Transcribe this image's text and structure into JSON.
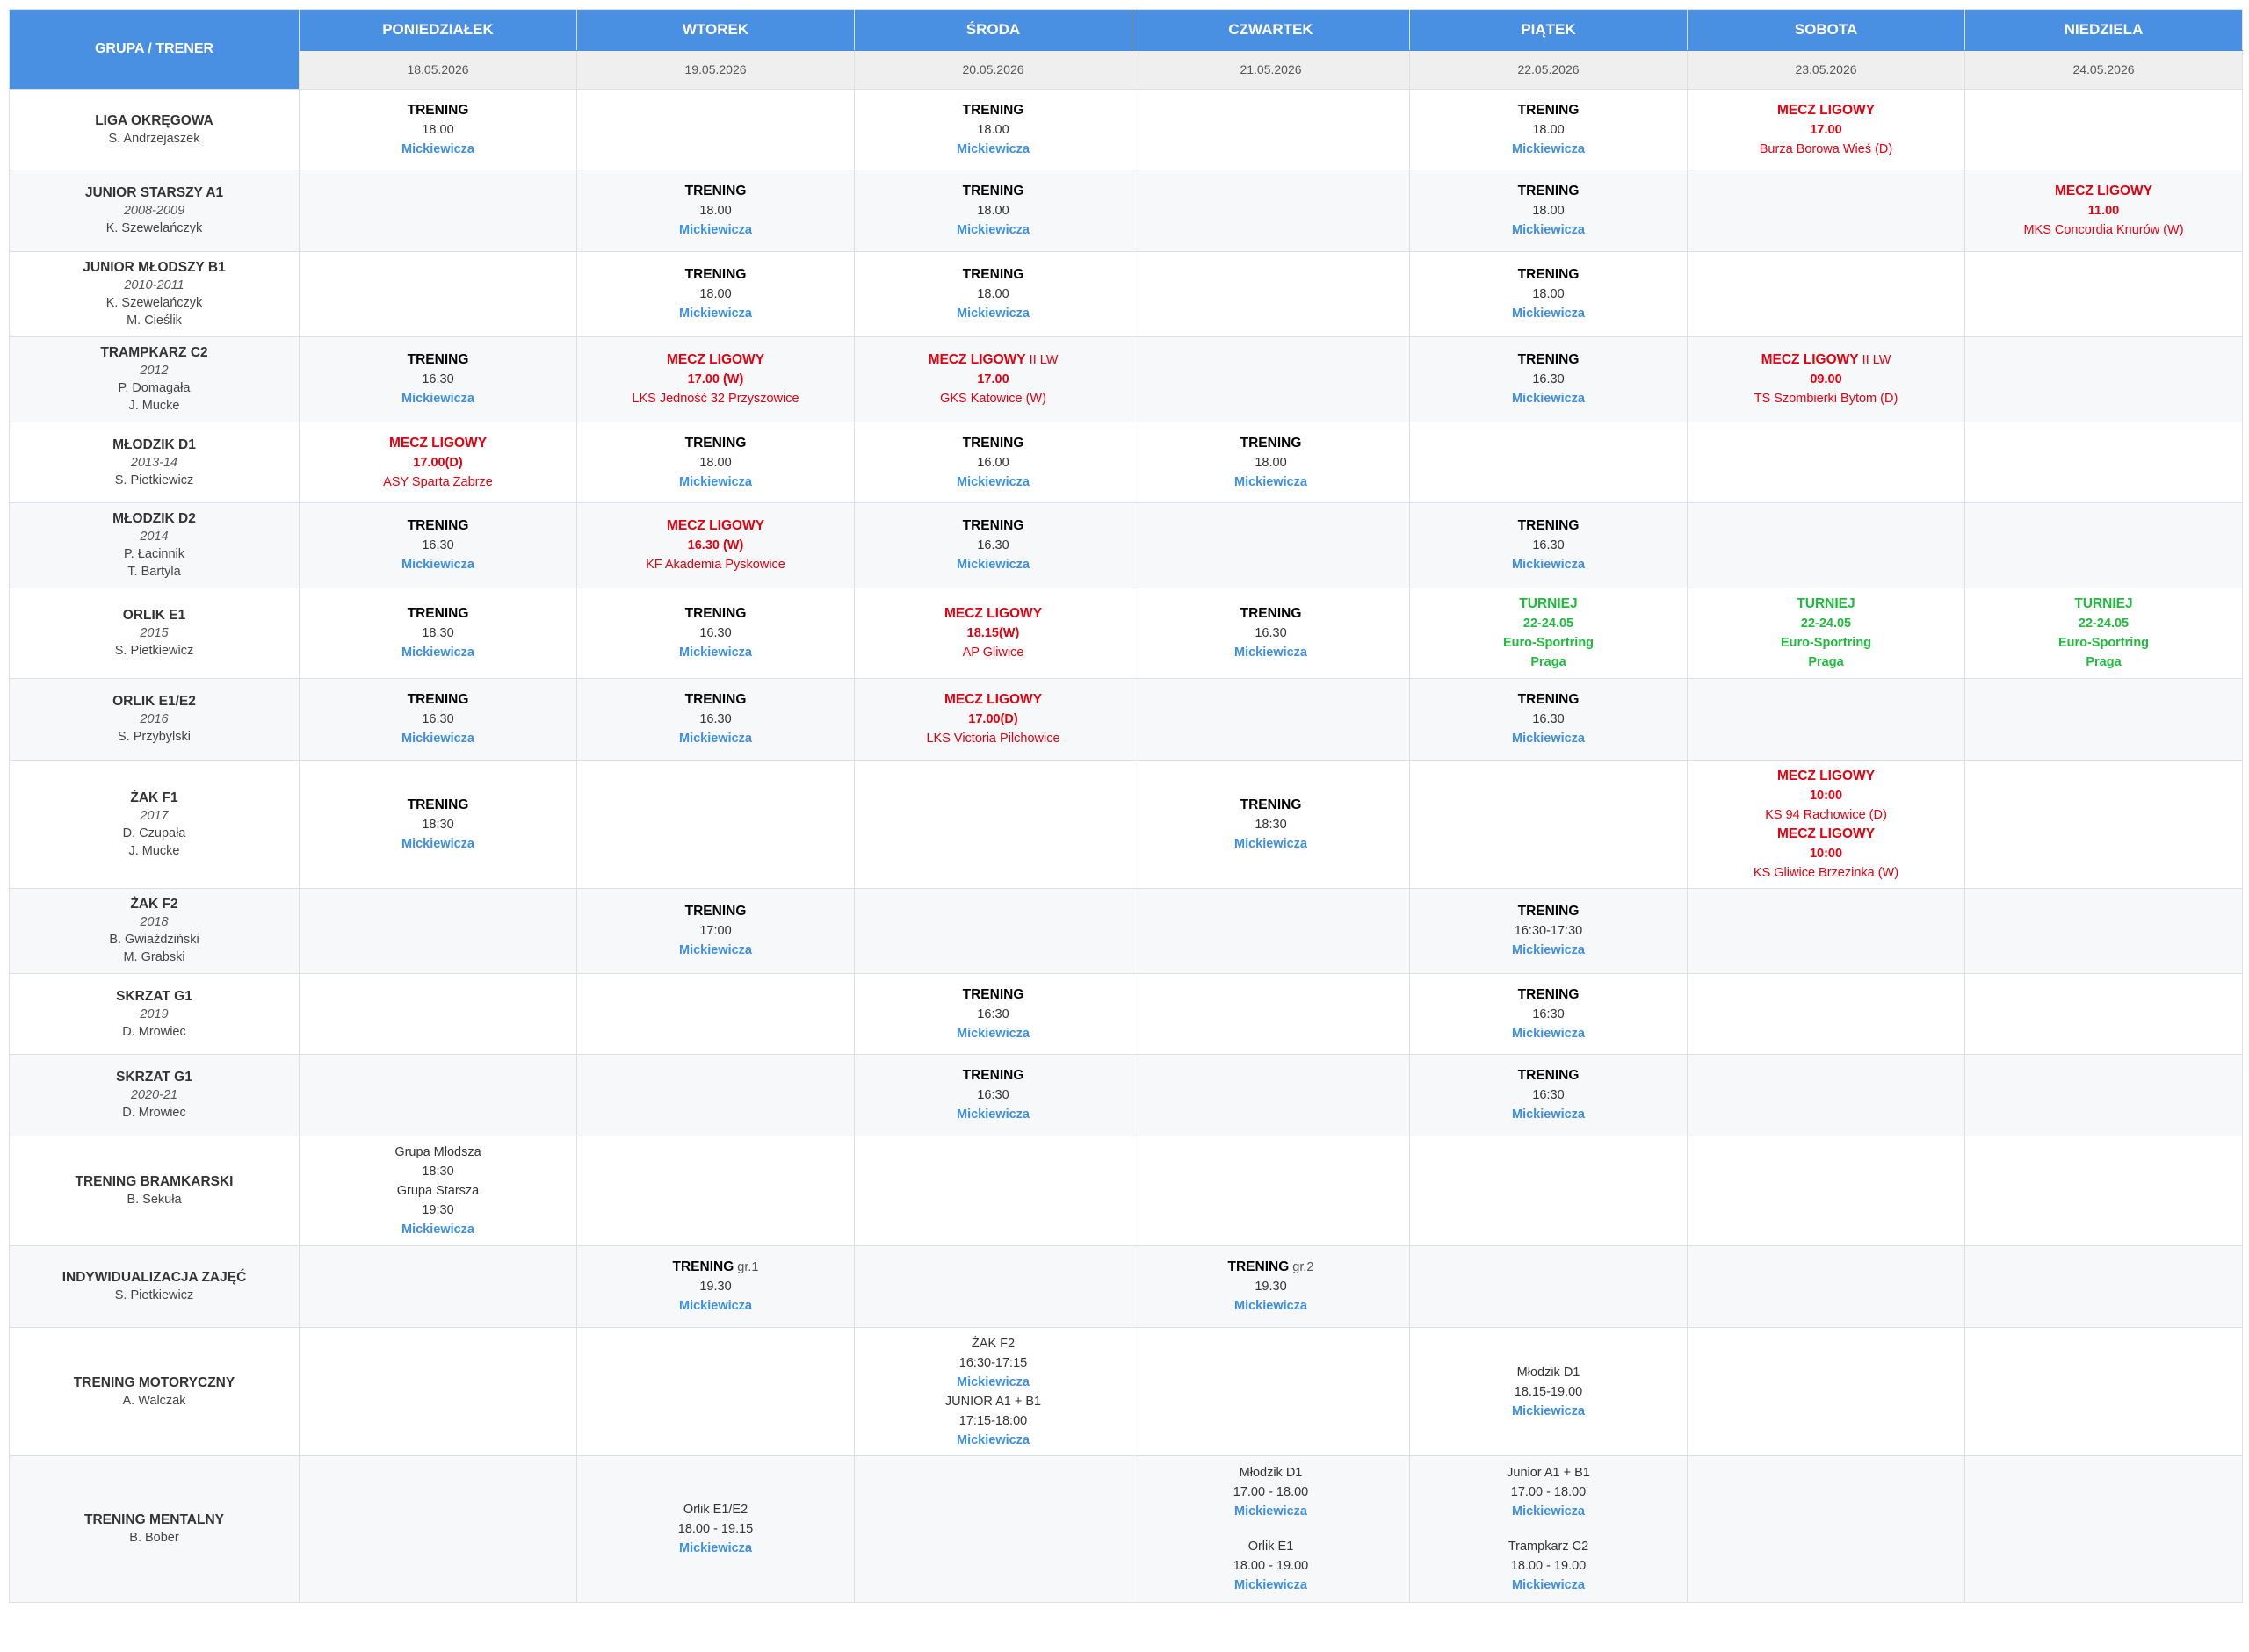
{
  "header": {
    "group_label": "GRUPA / TRENER",
    "days": [
      {
        "name": "PONIEDZIAŁEK",
        "date": "18.05.2026"
      },
      {
        "name": "WTOREK",
        "date": "19.05.2026"
      },
      {
        "name": "ŚRODA",
        "date": "20.05.2026"
      },
      {
        "name": "CZWARTEK",
        "date": "21.05.2026"
      },
      {
        "name": "PIĄTEK",
        "date": "22.05.2026"
      },
      {
        "name": "SOBOTA",
        "date": "23.05.2026"
      },
      {
        "name": "NIEDZIELA",
        "date": "24.05.2026"
      }
    ]
  },
  "colors": {
    "header_blue": "#4a90e2",
    "location_blue": "#3d8fe2",
    "match_red": "#e3000f",
    "tournament_green": "#1fbb3c",
    "alt_row": "#f7f8fa"
  },
  "rows": [
    {
      "group": {
        "name": "LIGA OKRĘGOWA",
        "year": "",
        "coaches": [
          "S. Andrzejaszek"
        ]
      },
      "height": 92,
      "cells": [
        [
          {
            "t": "type",
            "v": "TRENING"
          },
          {
            "t": "text",
            "v": "18.00"
          },
          {
            "t": "loc",
            "v": "Mickiewicza"
          }
        ],
        [],
        [
          {
            "t": "type",
            "v": "TRENING"
          },
          {
            "t": "text",
            "v": "18.00"
          },
          {
            "t": "loc",
            "v": "Mickiewicza"
          }
        ],
        [],
        [
          {
            "t": "type",
            "v": "TRENING"
          },
          {
            "t": "text",
            "v": "18.00"
          },
          {
            "t": "loc",
            "v": "Mickiewicza"
          }
        ],
        [
          {
            "t": "match",
            "v": "MECZ LIGOWY"
          },
          {
            "t": "red_bold",
            "v": "17.00"
          },
          {
            "t": "red",
            "v": "Burza Borowa Wieś (D)"
          }
        ],
        []
      ]
    },
    {
      "group": {
        "name": "JUNIOR STARSZY A1",
        "year": "2008-2009",
        "coaches": [
          "K. Szewelańczyk"
        ]
      },
      "height": 93,
      "cells": [
        [],
        [
          {
            "t": "type",
            "v": "TRENING"
          },
          {
            "t": "text",
            "v": "18.00"
          },
          {
            "t": "loc",
            "v": "Mickiewicza"
          }
        ],
        [
          {
            "t": "type",
            "v": "TRENING"
          },
          {
            "t": "text",
            "v": "18.00"
          },
          {
            "t": "loc",
            "v": "Mickiewicza"
          }
        ],
        [],
        [
          {
            "t": "type",
            "v": "TRENING"
          },
          {
            "t": "text",
            "v": "18.00"
          },
          {
            "t": "loc",
            "v": "Mickiewicza"
          }
        ],
        [],
        [
          {
            "t": "match",
            "v": "MECZ LIGOWY"
          },
          {
            "t": "red_bold",
            "v": "11.00"
          },
          {
            "t": "red",
            "v": "MKS Concordia Knurów (W)"
          }
        ]
      ]
    },
    {
      "group": {
        "name": "JUNIOR MŁODSZY B1",
        "year": "2010-2011",
        "coaches": [
          "K. Szewelańczyk",
          "M. Cieślik"
        ]
      },
      "height": 97,
      "cells": [
        [],
        [
          {
            "t": "type",
            "v": "TRENING"
          },
          {
            "t": "text",
            "v": "18.00"
          },
          {
            "t": "loc",
            "v": "Mickiewicza"
          }
        ],
        [
          {
            "t": "type",
            "v": "TRENING"
          },
          {
            "t": "text",
            "v": "18.00"
          },
          {
            "t": "loc",
            "v": "Mickiewicza"
          }
        ],
        [],
        [
          {
            "t": "type",
            "v": "TRENING"
          },
          {
            "t": "text",
            "v": "18.00"
          },
          {
            "t": "loc",
            "v": "Mickiewicza"
          }
        ],
        [],
        []
      ]
    },
    {
      "group": {
        "name": "TRAMPKARZ C2",
        "year": "2012",
        "coaches": [
          "P. Domagała",
          "J. Mucke"
        ]
      },
      "height": 97,
      "cells": [
        [
          {
            "t": "type",
            "v": "TRENING"
          },
          {
            "t": "text",
            "v": "16.30"
          },
          {
            "t": "loc",
            "v": "Mickiewicza"
          }
        ],
        [
          {
            "t": "match",
            "v": "MECZ LIGOWY"
          },
          {
            "t": "red_bold",
            "v": "17.00 (W)"
          },
          {
            "t": "red",
            "v": "LKS Jedność 32 Przyszowice"
          }
        ],
        [
          {
            "t": "match",
            "v": "MECZ LIGOWY",
            "s": "II LW"
          },
          {
            "t": "red_bold",
            "v": "17.00"
          },
          {
            "t": "red",
            "v": "GKS Katowice (W)"
          }
        ],
        [],
        [
          {
            "t": "type",
            "v": "TRENING"
          },
          {
            "t": "text",
            "v": "16.30"
          },
          {
            "t": "loc",
            "v": "Mickiewicza"
          }
        ],
        [
          {
            "t": "match",
            "v": "MECZ LIGOWY",
            "s": "II LW"
          },
          {
            "t": "red_bold",
            "v": "09.00"
          },
          {
            "t": "red",
            "v": "TS Szombierki Bytom (D)"
          }
        ],
        []
      ]
    },
    {
      "group": {
        "name": "MŁODZIK D1",
        "year": "2013-14",
        "coaches": [
          "S. Pietkiewicz"
        ]
      },
      "height": 92,
      "cells": [
        [
          {
            "t": "match",
            "v": "MECZ LIGOWY"
          },
          {
            "t": "red_bold",
            "v": "17.00(D)"
          },
          {
            "t": "red",
            "v": "ASY Sparta Zabrze"
          }
        ],
        [
          {
            "t": "type",
            "v": "TRENING"
          },
          {
            "t": "text",
            "v": "18.00"
          },
          {
            "t": "loc",
            "v": "Mickiewicza"
          }
        ],
        [
          {
            "t": "type",
            "v": "TRENING"
          },
          {
            "t": "text",
            "v": "16.00"
          },
          {
            "t": "loc",
            "v": "Mickiewicza"
          }
        ],
        [
          {
            "t": "type",
            "v": "TRENING"
          },
          {
            "t": "text",
            "v": "18.00"
          },
          {
            "t": "loc",
            "v": "Mickiewicza"
          }
        ],
        [],
        [],
        []
      ]
    },
    {
      "group": {
        "name": "MŁODZIK D2",
        "year": "2014",
        "coaches": [
          "P. Łacinnik",
          "T. Bartyla"
        ]
      },
      "height": 97,
      "cells": [
        [
          {
            "t": "type",
            "v": "TRENING"
          },
          {
            "t": "text",
            "v": "16.30"
          },
          {
            "t": "loc",
            "v": "Mickiewicza"
          }
        ],
        [
          {
            "t": "match",
            "v": "MECZ LIGOWY"
          },
          {
            "t": "red_bold",
            "v": "16.30 (W)"
          },
          {
            "t": "red",
            "v": "KF Akademia Pyskowice"
          }
        ],
        [
          {
            "t": "type",
            "v": "TRENING"
          },
          {
            "t": "text",
            "v": "16.30"
          },
          {
            "t": "loc",
            "v": "Mickiewicza"
          }
        ],
        [],
        [
          {
            "t": "type",
            "v": "TRENING"
          },
          {
            "t": "text",
            "v": "16.30"
          },
          {
            "t": "loc",
            "v": "Mickiewicza"
          }
        ],
        [],
        []
      ]
    },
    {
      "group": {
        "name": "ORLIK E1",
        "year": "2015",
        "coaches": [
          "S. Pietkiewicz"
        ]
      },
      "height": 103,
      "cells": [
        [
          {
            "t": "type",
            "v": "TRENING"
          },
          {
            "t": "text",
            "v": "18.30"
          },
          {
            "t": "loc",
            "v": "Mickiewicza"
          }
        ],
        [
          {
            "t": "type",
            "v": "TRENING"
          },
          {
            "t": "text",
            "v": "16.30"
          },
          {
            "t": "loc",
            "v": "Mickiewicza"
          }
        ],
        [
          {
            "t": "match",
            "v": "MECZ LIGOWY"
          },
          {
            "t": "red_bold",
            "v": "18.15(W)"
          },
          {
            "t": "red",
            "v": "AP Gliwice"
          }
        ],
        [
          {
            "t": "type",
            "v": "TRENING"
          },
          {
            "t": "text",
            "v": "16.30"
          },
          {
            "t": "loc",
            "v": "Mickiewicza"
          }
        ],
        [
          {
            "t": "tour",
            "v": "TURNIEJ"
          },
          {
            "t": "green",
            "v": "22-24.05"
          },
          {
            "t": "green",
            "v": "Euro-Sportring"
          },
          {
            "t": "green",
            "v": "Praga"
          }
        ],
        [
          {
            "t": "tour",
            "v": "TURNIEJ"
          },
          {
            "t": "green",
            "v": "22-24.05"
          },
          {
            "t": "green",
            "v": "Euro-Sportring"
          },
          {
            "t": "green",
            "v": "Praga"
          }
        ],
        [
          {
            "t": "tour",
            "v": "TURNIEJ"
          },
          {
            "t": "green",
            "v": "22-24.05"
          },
          {
            "t": "green",
            "v": "Euro-Sportring"
          },
          {
            "t": "green",
            "v": "Praga"
          }
        ]
      ]
    },
    {
      "group": {
        "name": "ORLIK E1/E2",
        "year": "2016",
        "coaches": [
          "S. Przybylski"
        ]
      },
      "height": 93,
      "cells": [
        [
          {
            "t": "type",
            "v": "TRENING"
          },
          {
            "t": "text",
            "v": "16.30"
          },
          {
            "t": "loc",
            "v": "Mickiewicza"
          }
        ],
        [
          {
            "t": "type",
            "v": "TRENING"
          },
          {
            "t": "text",
            "v": "16.30"
          },
          {
            "t": "loc",
            "v": "Mickiewicza"
          }
        ],
        [
          {
            "t": "match",
            "v": "MECZ LIGOWY"
          },
          {
            "t": "red_bold",
            "v": "17.00(D)"
          },
          {
            "t": "red",
            "v": "LKS Victoria Pilchowice"
          }
        ],
        [],
        [
          {
            "t": "type",
            "v": "TRENING"
          },
          {
            "t": "text",
            "v": "16.30"
          },
          {
            "t": "loc",
            "v": "Mickiewicza"
          }
        ],
        [],
        []
      ]
    },
    {
      "group": {
        "name": "ŻAK F1",
        "year": "2017",
        "coaches": [
          "D. Czupała",
          "J. Mucke"
        ]
      },
      "height": 146,
      "cells": [
        [
          {
            "t": "type",
            "v": "TRENING"
          },
          {
            "t": "text",
            "v": "18:30"
          },
          {
            "t": "loc",
            "v": "Mickiewicza"
          }
        ],
        [],
        [],
        [
          {
            "t": "type",
            "v": "TRENING"
          },
          {
            "t": "text",
            "v": "18:30"
          },
          {
            "t": "loc",
            "v": "Mickiewicza"
          }
        ],
        [],
        [
          {
            "t": "match",
            "v": "MECZ LIGOWY"
          },
          {
            "t": "red_bold",
            "v": "10:00"
          },
          {
            "t": "red",
            "v": "KS 94 Rachowice (D)"
          },
          {
            "t": "match",
            "v": "MECZ LIGOWY"
          },
          {
            "t": "red_bold",
            "v": "10:00"
          },
          {
            "t": "red",
            "v": "KS Gliwice Brzezinka (W)"
          }
        ],
        []
      ]
    },
    {
      "group": {
        "name": "ŻAK F2",
        "year": "2018",
        "coaches": [
          "B. Gwiaździński",
          "M. Grabski"
        ]
      },
      "height": 97,
      "cells": [
        [],
        [
          {
            "t": "type",
            "v": "TRENING"
          },
          {
            "t": "text",
            "v": "17:00"
          },
          {
            "t": "loc",
            "v": "Mickiewicza"
          }
        ],
        [],
        [],
        [
          {
            "t": "type",
            "v": "TRENING"
          },
          {
            "t": "text",
            "v": "16:30-17:30"
          },
          {
            "t": "loc",
            "v": "Mickiewicza"
          }
        ],
        [],
        []
      ]
    },
    {
      "group": {
        "name": "SKRZAT G1",
        "year": "2019",
        "coaches": [
          "D. Mrowiec"
        ]
      },
      "height": 92,
      "cells": [
        [],
        [],
        [
          {
            "t": "type",
            "v": "TRENING"
          },
          {
            "t": "text",
            "v": "16:30"
          },
          {
            "t": "loc",
            "v": "Mickiewicza"
          }
        ],
        [],
        [
          {
            "t": "type",
            "v": "TRENING"
          },
          {
            "t": "text",
            "v": "16:30"
          },
          {
            "t": "loc",
            "v": "Mickiewicza"
          }
        ],
        [],
        []
      ]
    },
    {
      "group": {
        "name": "SKRZAT G1",
        "year": "2020-21",
        "coaches": [
          "D. Mrowiec"
        ]
      },
      "height": 93,
      "cells": [
        [],
        [],
        [
          {
            "t": "type",
            "v": "TRENING"
          },
          {
            "t": "text",
            "v": "16:30"
          },
          {
            "t": "loc",
            "v": "Mickiewicza"
          }
        ],
        [],
        [
          {
            "t": "type",
            "v": "TRENING"
          },
          {
            "t": "text",
            "v": "16:30"
          },
          {
            "t": "loc",
            "v": "Mickiewicza"
          }
        ],
        [],
        []
      ]
    },
    {
      "group": {
        "name": "TRENING BRAMKARSKI",
        "year": "",
        "coaches": [
          "B. Sekuła"
        ]
      },
      "height": 125,
      "cells": [
        [
          {
            "t": "text",
            "v": "Grupa Młodsza"
          },
          {
            "t": "text",
            "v": "18:30"
          },
          {
            "t": "text",
            "v": "Grupa Starsza"
          },
          {
            "t": "text",
            "v": "19:30"
          },
          {
            "t": "loc",
            "v": "Mickiewicza"
          }
        ],
        [],
        [],
        [],
        [],
        [],
        []
      ]
    },
    {
      "group": {
        "name": "INDYWIDUALIZACJA ZAJĘĆ",
        "year": "",
        "coaches": [
          "S. Pietkiewicz"
        ]
      },
      "height": 93,
      "cells": [
        [],
        [
          {
            "t": "type",
            "v": "TRENING",
            "s": "gr.1"
          },
          {
            "t": "text",
            "v": "19.30"
          },
          {
            "t": "loc",
            "v": "Mickiewicza"
          }
        ],
        [],
        [
          {
            "t": "type",
            "v": "TRENING",
            "s": "gr.2"
          },
          {
            "t": "text",
            "v": "19.30"
          },
          {
            "t": "loc",
            "v": "Mickiewicza"
          }
        ],
        [],
        [],
        []
      ]
    },
    {
      "group": {
        "name": "TRENING MOTORYCZNY",
        "year": "",
        "coaches": [
          "A. Walczak"
        ]
      },
      "height": 146,
      "cells": [
        [],
        [],
        [
          {
            "t": "text",
            "v": "ŻAK F2"
          },
          {
            "t": "text",
            "v": "16:30-17:15"
          },
          {
            "t": "loc",
            "v": "Mickiewicza"
          },
          {
            "t": "text",
            "v": "JUNIOR A1 + B1"
          },
          {
            "t": "text",
            "v": "17:15-18:00"
          },
          {
            "t": "loc",
            "v": "Mickiewicza"
          }
        ],
        [],
        [
          {
            "t": "text",
            "v": "Młodzik D1"
          },
          {
            "t": "text",
            "v": "18.15-19.00"
          },
          {
            "t": "loc",
            "v": "Mickiewicza"
          }
        ],
        [],
        []
      ]
    },
    {
      "group": {
        "name": "TRENING MENTALNY",
        "year": "",
        "coaches": [
          "B. Bober"
        ]
      },
      "height": 167,
      "cells": [
        [],
        [
          {
            "t": "text",
            "v": "Orlik E1/E2"
          },
          {
            "t": "text",
            "v": "18.00 - 19.15"
          },
          {
            "t": "loc",
            "v": "Mickiewicza"
          }
        ],
        [],
        [
          {
            "t": "text",
            "v": "Młodzik D1"
          },
          {
            "t": "text",
            "v": "17.00 - 18.00"
          },
          {
            "t": "loc",
            "v": "Mickiewicza"
          },
          {
            "t": "gap",
            "v": ""
          },
          {
            "t": "text",
            "v": "Orlik E1"
          },
          {
            "t": "text",
            "v": "18.00 - 19.00"
          },
          {
            "t": "loc",
            "v": "Mickiewicza"
          }
        ],
        [
          {
            "t": "text",
            "v": "Junior A1 + B1"
          },
          {
            "t": "text",
            "v": "17.00 - 18.00"
          },
          {
            "t": "loc",
            "v": "Mickiewicza"
          },
          {
            "t": "gap",
            "v": ""
          },
          {
            "t": "text",
            "v": "Trampkarz C2"
          },
          {
            "t": "text",
            "v": "18.00 - 19.00"
          },
          {
            "t": "loc",
            "v": "Mickiewicza"
          }
        ],
        [],
        []
      ]
    }
  ]
}
